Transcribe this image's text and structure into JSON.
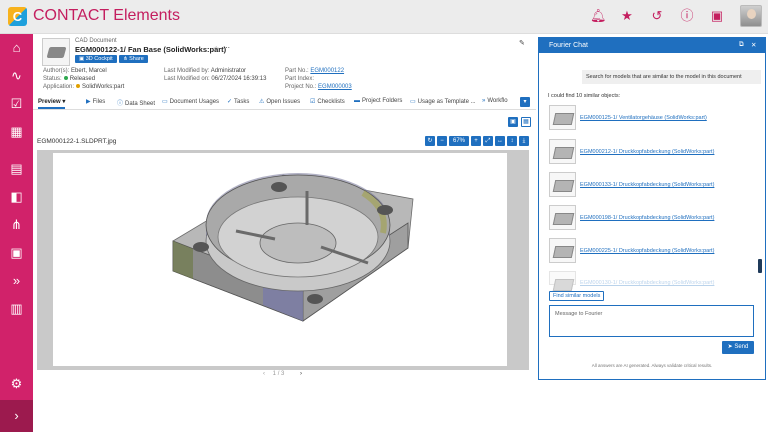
{
  "app": {
    "logo_letter": "C",
    "title": "CONTACT Elements"
  },
  "top_icons": [
    "bell-icon",
    "star-icon",
    "history-icon",
    "info-icon",
    "gallery-icon"
  ],
  "sidebar": {
    "items": [
      "home-icon",
      "activity-icon",
      "tasks-icon",
      "table-icon",
      "document-icon",
      "box-icon",
      "share-icon",
      "dashboard-icon",
      "forward-icon",
      "building-icon",
      "settings-icon",
      "expand-icon"
    ]
  },
  "document": {
    "type": "CAD Document",
    "title": "EGM000122-1/ Fan Base (SolidWorks:part)",
    "cockpit_label": "3D Cockpit",
    "share_label": "Share",
    "authors_label": "Author(s):",
    "authors": "Ebert, Marcel",
    "status_label": "Status:",
    "status": "Released",
    "application_label": "Application:",
    "application": "SolidWorks:part",
    "modified_by_label": "Last Modified by:",
    "modified_by": "Administrator",
    "modified_on_label": "Last Modified on:",
    "modified_on": "06/27/2024 16:39:13",
    "part_no_label": "Part No.:",
    "part_no": "EGM000122",
    "part_index_label": "Part Index:",
    "part_index": "",
    "project_no_label": "Project No.:",
    "project_no": "EGM000003"
  },
  "tabs": [
    {
      "label": "Preview",
      "icon": "▾",
      "active": true
    },
    {
      "label": "Files",
      "icon": "▶"
    },
    {
      "label": "Data Sheet",
      "icon": "ⓘ"
    },
    {
      "label": "Document Usages",
      "icon": "▭"
    },
    {
      "label": "Tasks",
      "icon": "✓"
    },
    {
      "label": "Open Issues",
      "icon": "⚠"
    },
    {
      "label": "Checklists",
      "icon": "☑"
    },
    {
      "label": "Project Folders",
      "icon": "▬"
    },
    {
      "label": "Usage as Template ...",
      "icon": "▭"
    },
    {
      "label": "Workflo",
      "icon": "»"
    }
  ],
  "viewer": {
    "file_name": "EGM000122-1.SLDPRT.jpg",
    "zoom": "67%",
    "page_current": "1",
    "page_total": "3",
    "page_separator": "/"
  },
  "chat": {
    "title": "Fourier Chat",
    "user_message": "Search for models that are similar to the model in this document",
    "bot_message": "I could find 10 similar objects:",
    "results": [
      "EGM000125-1/ Ventilatorgehäuse (SolidWorks:part)",
      "EGM000212-1/ Druckkopfabdeckung (SolidWorks:part)",
      "EGM000133-1/ Druckkopfabdeckung (SolidWorks:part)",
      "EGM000198-1/ Druckkopfabdeckung (SolidWorks:part)",
      "EGM000225-1/ Druckkopfabdeckung (SolidWorks:part)",
      "EGM000130-1/ Druckkopfabdeckung (SolidWorks:part)"
    ],
    "find_label": "Find similar models",
    "input_placeholder": "Message to Fourier",
    "send_label": "Send",
    "disclaimer": "All answers are AI generated. Always validate critical results."
  },
  "colors": {
    "brand": "#d1226a",
    "accent": "#1f6fbf",
    "title_text": "#c41e5f"
  }
}
